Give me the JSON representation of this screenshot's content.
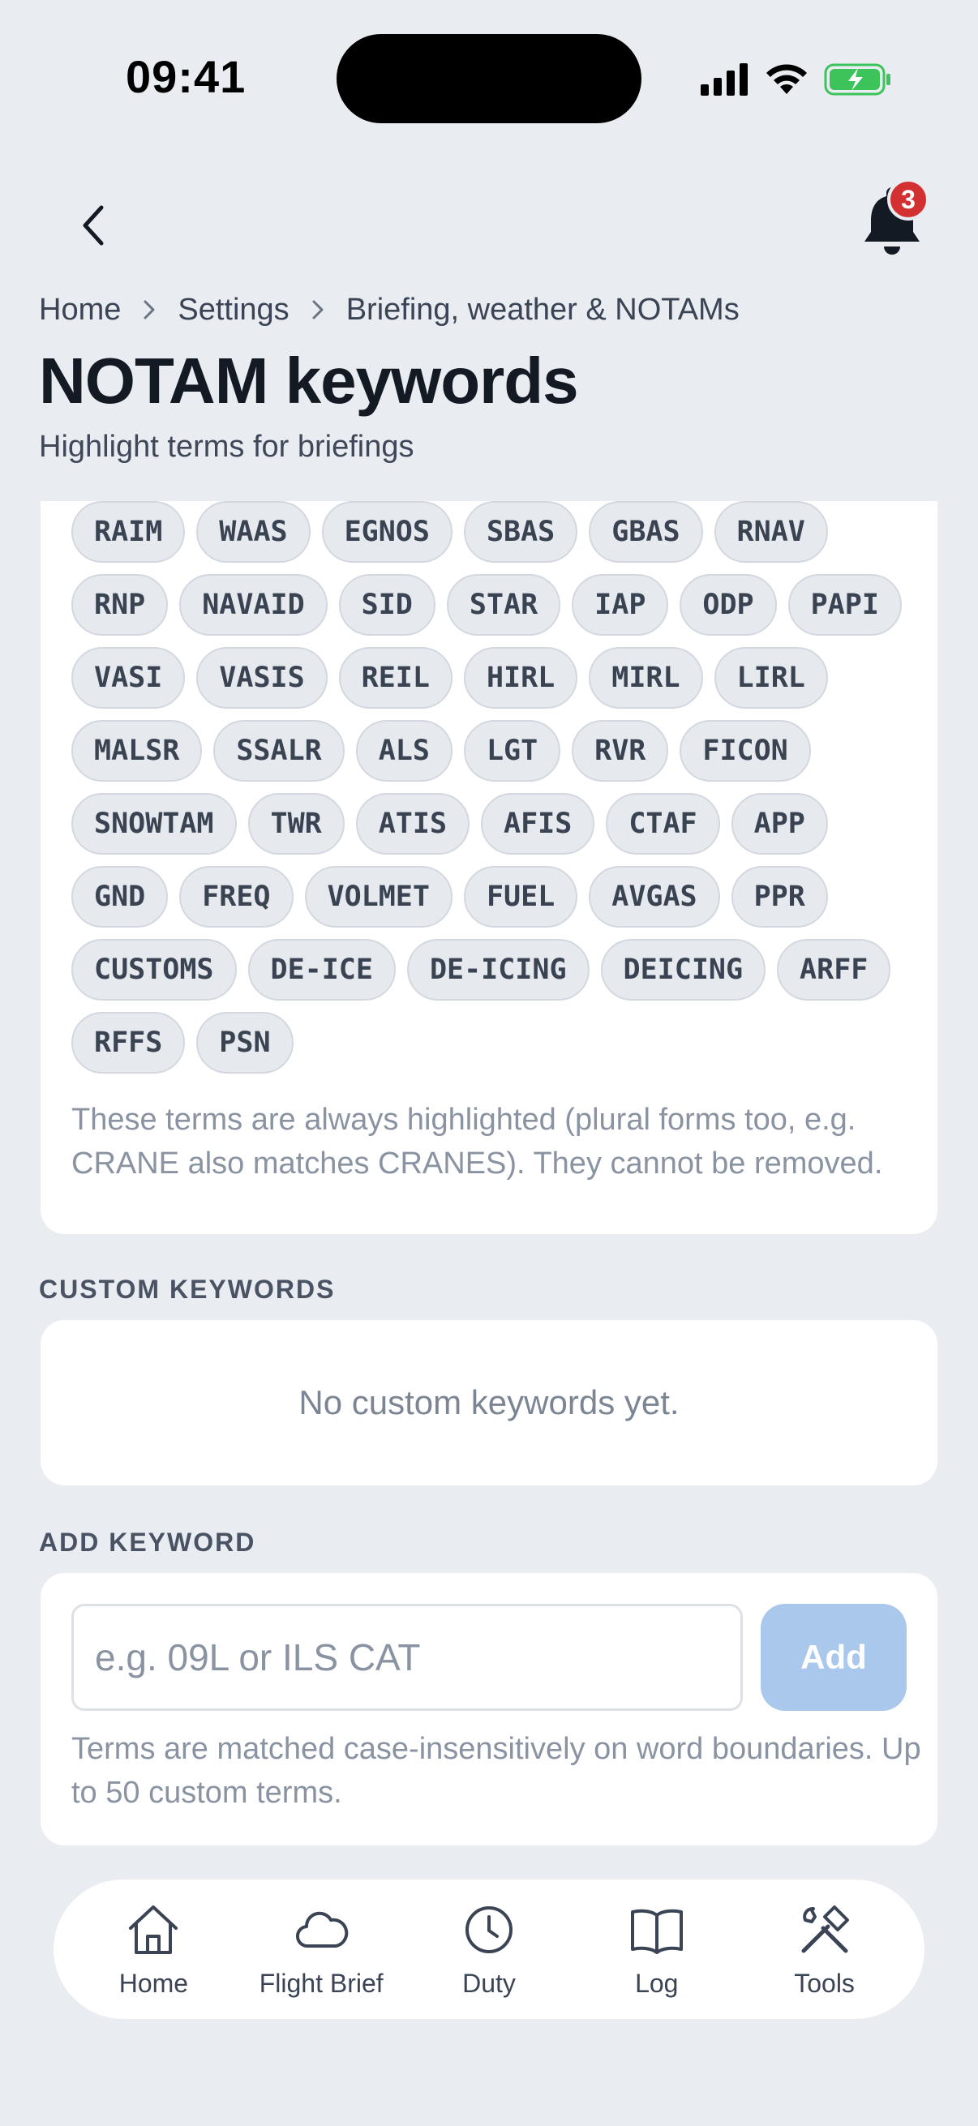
{
  "status_bar": {
    "time": "09:41"
  },
  "header": {
    "notification_count": "3"
  },
  "breadcrumb": {
    "items": [
      "Home",
      "Settings",
      "Briefing, weather & NOTAMs"
    ]
  },
  "page": {
    "title": "NOTAM keywords",
    "subtitle": "Highlight terms for briefings"
  },
  "default_keywords": {
    "chips": [
      "RAIM",
      "WAAS",
      "EGNOS",
      "SBAS",
      "GBAS",
      "RNAV",
      "RNP",
      "NAVAID",
      "SID",
      "STAR",
      "IAP",
      "ODP",
      "PAPI",
      "VASI",
      "VASIS",
      "REIL",
      "HIRL",
      "MIRL",
      "LIRL",
      "MALSR",
      "SSALR",
      "ALS",
      "LGT",
      "RVR",
      "FICON",
      "SNOWTAM",
      "TWR",
      "ATIS",
      "AFIS",
      "CTAF",
      "APP",
      "GND",
      "FREQ",
      "VOLMET",
      "FUEL",
      "AVGAS",
      "PPR",
      "CUSTOMS",
      "DE-ICE",
      "DE-ICING",
      "DEICING",
      "ARFF",
      "RFFS",
      "PSN"
    ],
    "note": "These terms are always highlighted (plural forms too, e.g. CRANE also matches CRANES). They cannot be removed."
  },
  "custom_keywords": {
    "label": "CUSTOM KEYWORDS",
    "empty_text": "No custom keywords yet."
  },
  "add_keyword": {
    "label": "ADD KEYWORD",
    "placeholder": "e.g. 09L or ILS CAT",
    "value": "",
    "button_label": "Add",
    "note": "Terms are matched case-insensitively on word boundaries. Up to 50 custom terms."
  },
  "tab_bar": {
    "tabs": [
      {
        "label": "Home",
        "icon": "home-icon"
      },
      {
        "label": "Flight Brief",
        "icon": "cloud-icon"
      },
      {
        "label": "Duty",
        "icon": "clock-icon"
      },
      {
        "label": "Log",
        "icon": "book-icon"
      },
      {
        "label": "Tools",
        "icon": "tools-icon"
      }
    ]
  },
  "colors": {
    "background": "#e9ecf1",
    "badge": "#d33131",
    "add_button_disabled": "#a9c8ec",
    "battery": "#3cc45a"
  }
}
